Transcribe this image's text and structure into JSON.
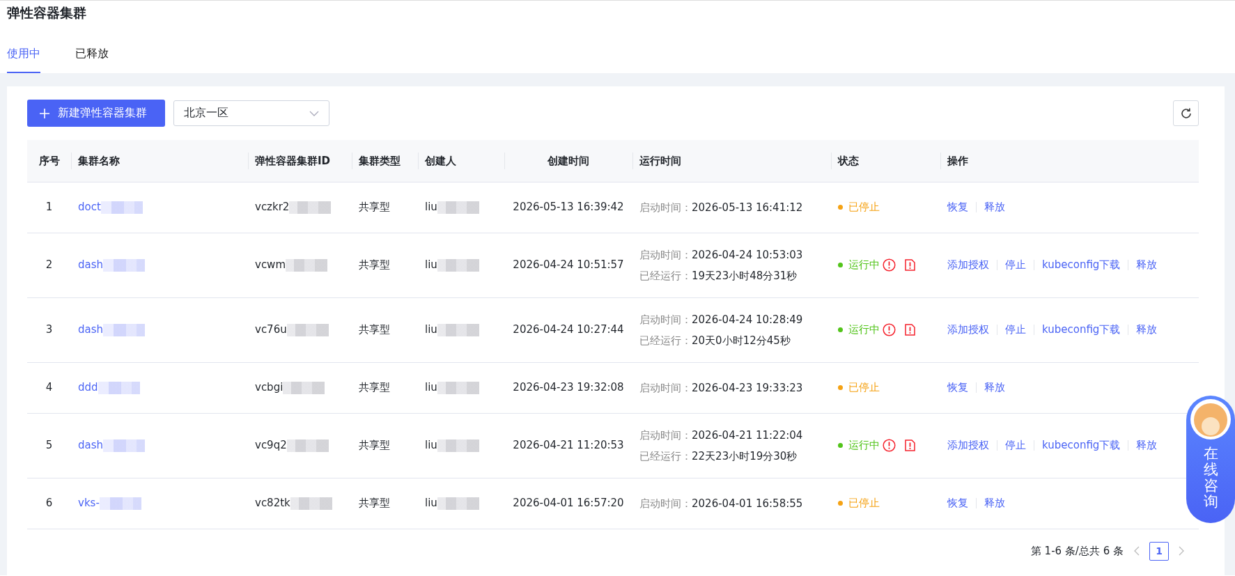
{
  "page_title": "弹性容器集群",
  "tabs": [
    {
      "label": "使用中",
      "selected": true
    },
    {
      "label": "已释放",
      "selected": false
    }
  ],
  "toolbar": {
    "create_button": "新建弹性容器集群",
    "region_select": {
      "value": "北京一区"
    }
  },
  "table": {
    "columns": [
      "序号",
      "集群名称",
      "弹性容器集群ID",
      "集群类型",
      "创建人",
      "创建时间",
      "运行时间",
      "状态",
      "操作"
    ],
    "rows": [
      {
        "index": "1",
        "name": "doct",
        "cluster_id": "vczkr2",
        "type": "共享型",
        "creator": "liu",
        "created": "2026-05-13 16:39:42",
        "runtime": [
          {
            "label": "启动时间：",
            "value": "2026-05-13 16:41:12"
          }
        ],
        "status": {
          "kind": "stopped",
          "label": "已停止"
        },
        "alert_icons": false,
        "actions": [
          "恢复",
          "释放"
        ]
      },
      {
        "index": "2",
        "name": "dash",
        "cluster_id": "vcwm",
        "type": "共享型",
        "creator": "liu",
        "created": "2026-04-24 10:51:57",
        "runtime": [
          {
            "label": "启动时间：",
            "value": "2026-04-24 10:53:03"
          },
          {
            "label": "已经运行：",
            "value": "19天23小时48分31秒"
          }
        ],
        "status": {
          "kind": "running",
          "label": "运行中"
        },
        "alert_icons": true,
        "actions": [
          "添加授权",
          "停止",
          "kubeconfig下载",
          "释放"
        ]
      },
      {
        "index": "3",
        "name": "dash",
        "cluster_id": "vc76u",
        "type": "共享型",
        "creator": "liu",
        "created": "2026-04-24 10:27:44",
        "runtime": [
          {
            "label": "启动时间：",
            "value": "2026-04-24 10:28:49"
          },
          {
            "label": "已经运行：",
            "value": "20天0小时12分45秒"
          }
        ],
        "status": {
          "kind": "running",
          "label": "运行中"
        },
        "alert_icons": true,
        "actions": [
          "添加授权",
          "停止",
          "kubeconfig下载",
          "释放"
        ]
      },
      {
        "index": "4",
        "name": "ddd",
        "cluster_id": "vcbgi",
        "type": "共享型",
        "creator": "liu",
        "created": "2026-04-23 19:32:08",
        "runtime": [
          {
            "label": "启动时间：",
            "value": "2026-04-23 19:33:23"
          }
        ],
        "status": {
          "kind": "stopped",
          "label": "已停止"
        },
        "alert_icons": false,
        "actions": [
          "恢复",
          "释放"
        ]
      },
      {
        "index": "5",
        "name": "dash",
        "cluster_id": "vc9q2",
        "type": "共享型",
        "creator": "liu",
        "created": "2026-04-21 11:20:53",
        "runtime": [
          {
            "label": "启动时间：",
            "value": "2026-04-21 11:22:04"
          },
          {
            "label": "已经运行：",
            "value": "22天23小时19分30秒"
          }
        ],
        "status": {
          "kind": "running",
          "label": "运行中"
        },
        "alert_icons": true,
        "actions": [
          "添加授权",
          "停止",
          "kubeconfig下载",
          "释放"
        ]
      },
      {
        "index": "6",
        "name": "vks-",
        "cluster_id": "vc82tk",
        "type": "共享型",
        "creator": "liu",
        "created": "2026-04-01 16:57:20",
        "runtime": [
          {
            "label": "启动时间：",
            "value": "2026-04-01 16:58:55"
          }
        ],
        "status": {
          "kind": "stopped",
          "label": "已停止"
        },
        "alert_icons": false,
        "actions": [
          "恢复",
          "释放"
        ]
      }
    ]
  },
  "pagination": {
    "summary": "第 1-6 条/总共 6 条",
    "pages": [
      {
        "label": "1",
        "selected": true
      }
    ]
  },
  "chat_widget": {
    "label": "在线咨询"
  }
}
